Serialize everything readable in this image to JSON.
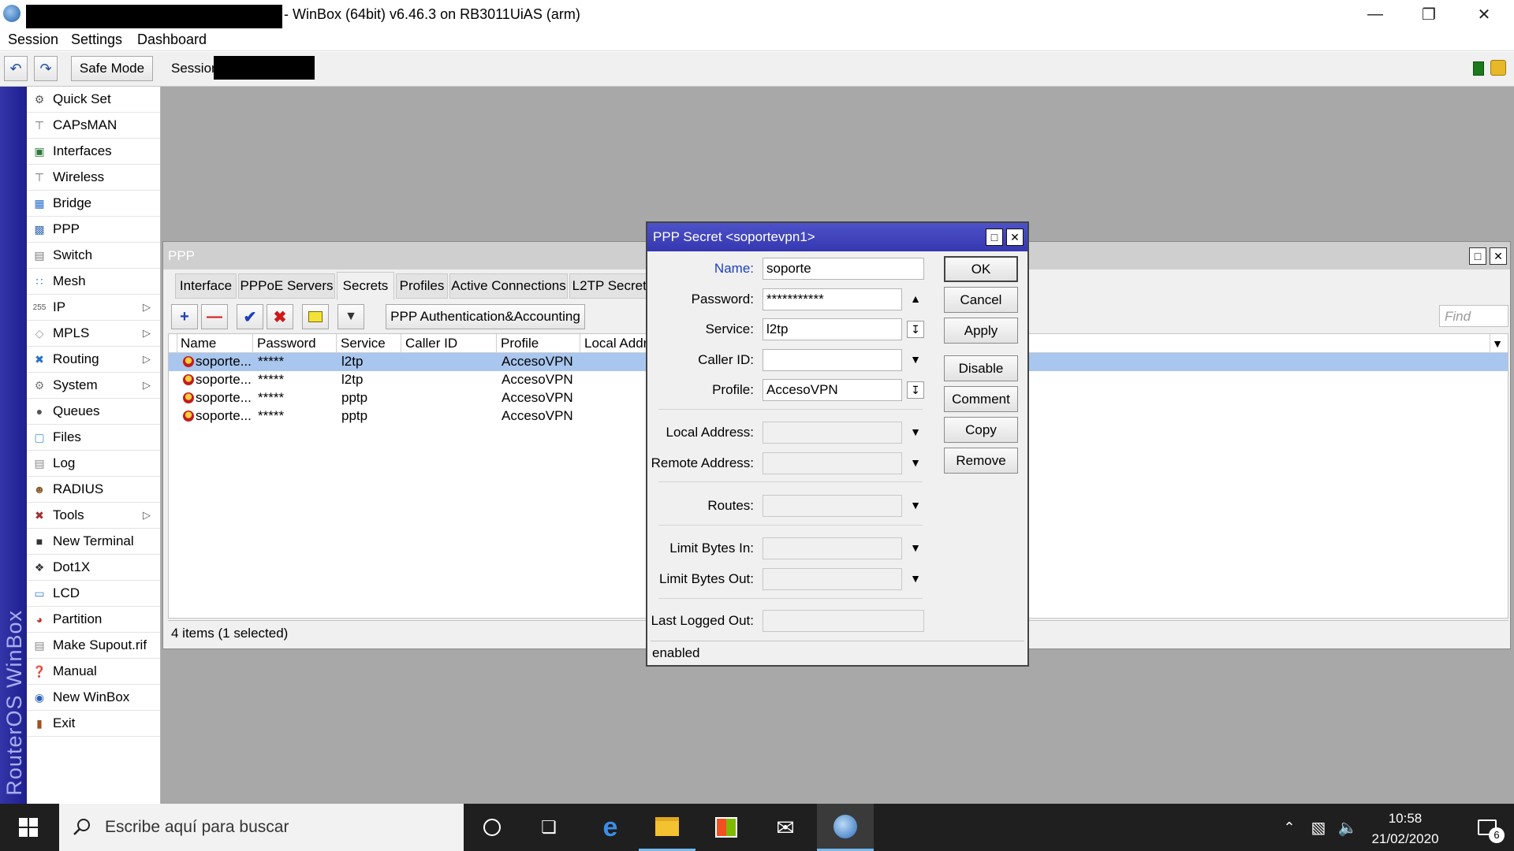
{
  "window": {
    "title": "- WinBox (64bit) v6.46.3 on RB3011UiAS (arm)"
  },
  "menu": [
    "Session",
    "Settings",
    "Dashboard"
  ],
  "toolbar": {
    "safe_mode": "Safe Mode",
    "session_label": "Session"
  },
  "sidebar": {
    "brand": "RouterOS WinBox",
    "items": [
      {
        "label": "Quick Set",
        "icon": "quick-set-icon",
        "arrow": false
      },
      {
        "label": "CAPsMAN",
        "icon": "capsman-icon",
        "arrow": false
      },
      {
        "label": "Interfaces",
        "icon": "interfaces-icon",
        "arrow": false
      },
      {
        "label": "Wireless",
        "icon": "wireless-icon",
        "arrow": false
      },
      {
        "label": "Bridge",
        "icon": "bridge-icon",
        "arrow": false
      },
      {
        "label": "PPP",
        "icon": "ppp-icon",
        "arrow": false
      },
      {
        "label": "Switch",
        "icon": "switch-icon",
        "arrow": false
      },
      {
        "label": "Mesh",
        "icon": "mesh-icon",
        "arrow": false
      },
      {
        "label": "IP",
        "icon": "ip-icon",
        "arrow": true
      },
      {
        "label": "MPLS",
        "icon": "mpls-icon",
        "arrow": true
      },
      {
        "label": "Routing",
        "icon": "routing-icon",
        "arrow": true
      },
      {
        "label": "System",
        "icon": "system-icon",
        "arrow": true
      },
      {
        "label": "Queues",
        "icon": "queues-icon",
        "arrow": false
      },
      {
        "label": "Files",
        "icon": "files-icon",
        "arrow": false
      },
      {
        "label": "Log",
        "icon": "log-icon",
        "arrow": false
      },
      {
        "label": "RADIUS",
        "icon": "radius-icon",
        "arrow": false
      },
      {
        "label": "Tools",
        "icon": "tools-icon",
        "arrow": true
      },
      {
        "label": "New Terminal",
        "icon": "terminal-icon",
        "arrow": false
      },
      {
        "label": "Dot1X",
        "icon": "dot1x-icon",
        "arrow": false
      },
      {
        "label": "LCD",
        "icon": "lcd-icon",
        "arrow": false
      },
      {
        "label": "Partition",
        "icon": "partition-icon",
        "arrow": false
      },
      {
        "label": "Make Supout.rif",
        "icon": "supout-icon",
        "arrow": false
      },
      {
        "label": "Manual",
        "icon": "manual-icon",
        "arrow": false
      },
      {
        "label": "New WinBox",
        "icon": "winbox-icon",
        "arrow": false
      },
      {
        "label": "Exit",
        "icon": "exit-icon",
        "arrow": false
      }
    ]
  },
  "ppp": {
    "title": "PPP",
    "tabs": [
      "Interface",
      "PPPoE Servers",
      "Secrets",
      "Profiles",
      "Active Connections",
      "L2TP Secrets"
    ],
    "active_tab": "Secrets",
    "auth_button": "PPP Authentication&Accounting",
    "find_placeholder": "Find",
    "columns": [
      "Name",
      "Password",
      "Service",
      "Caller ID",
      "Profile",
      "Local Addr"
    ],
    "rows": [
      {
        "name": "soporte...",
        "password": "*****",
        "service": "l2tp",
        "caller_id": "",
        "profile": "AccesoVPN",
        "selected": true
      },
      {
        "name": "soporte...",
        "password": "*****",
        "service": "l2tp",
        "caller_id": "",
        "profile": "AccesoVPN",
        "selected": false
      },
      {
        "name": "soporte...",
        "password": "*****",
        "service": "pptp",
        "caller_id": "",
        "profile": "AccesoVPN",
        "selected": false
      },
      {
        "name": "soporte...",
        "password": "*****",
        "service": "pptp",
        "caller_id": "",
        "profile": "AccesoVPN",
        "selected": false
      }
    ],
    "status": "4 items (1 selected)"
  },
  "dialog": {
    "title": "PPP Secret <soportevpn1>",
    "fields": {
      "name": {
        "label": "Name:",
        "value": "soporte"
      },
      "password": {
        "label": "Password:",
        "value": "***********"
      },
      "service": {
        "label": "Service:",
        "value": "l2tp"
      },
      "caller_id": {
        "label": "Caller ID:",
        "value": ""
      },
      "profile": {
        "label": "Profile:",
        "value": "AccesoVPN"
      },
      "local_address": {
        "label": "Local Address:",
        "value": ""
      },
      "remote_address": {
        "label": "Remote Address:",
        "value": ""
      },
      "routes": {
        "label": "Routes:",
        "value": ""
      },
      "limit_in": {
        "label": "Limit Bytes In:",
        "value": ""
      },
      "limit_out": {
        "label": "Limit Bytes Out:",
        "value": ""
      },
      "last_logged_out": {
        "label": "Last Logged Out:",
        "value": ""
      }
    },
    "buttons": [
      "OK",
      "Cancel",
      "Apply",
      "Disable",
      "Comment",
      "Copy",
      "Remove"
    ],
    "status": "enabled"
  },
  "taskbar": {
    "search_placeholder": "Escribe aquí para buscar",
    "time": "10:58",
    "date": "21/02/2020",
    "notifications": "6"
  },
  "colors": {
    "dialog_title": "#3e41bd",
    "brand_strip": "#2a2c9e",
    "selected_row": "#a9c6ee"
  }
}
